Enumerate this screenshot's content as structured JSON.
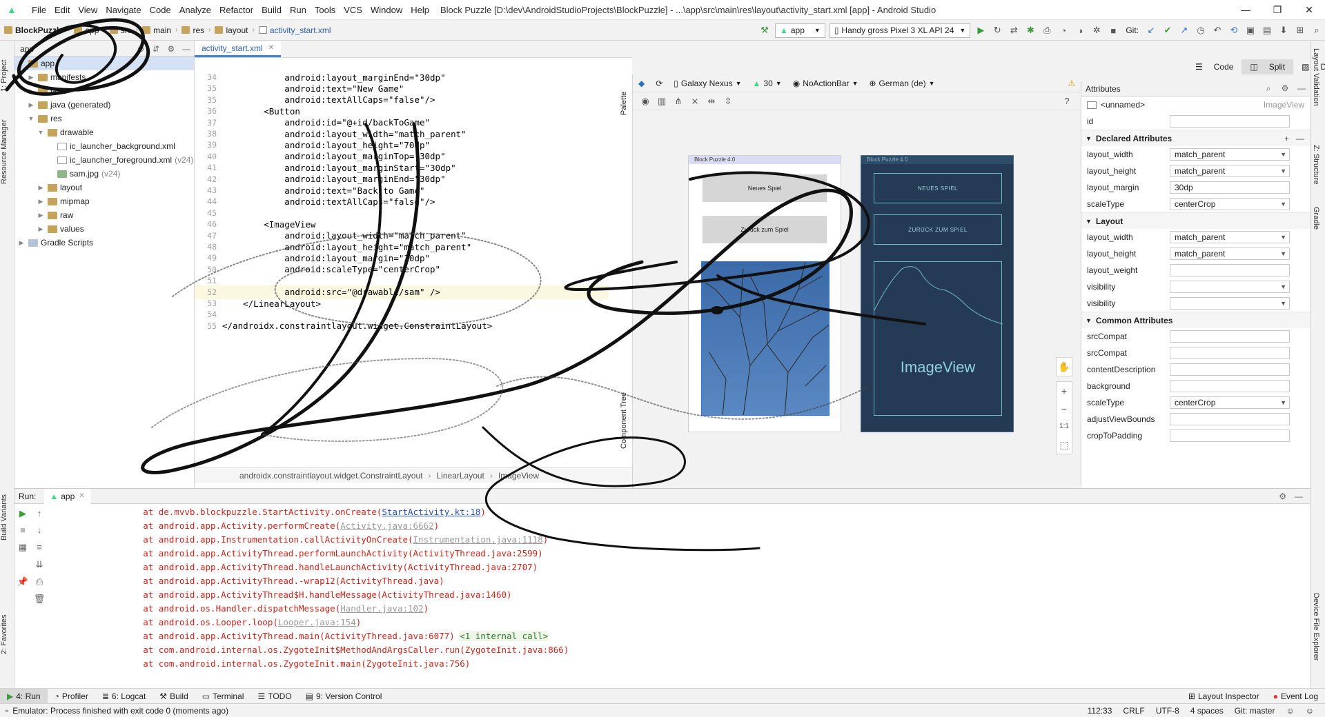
{
  "window": {
    "title": "Block Puzzle [D:\\dev\\AndroidStudioProjects\\BlockPuzzle] - ...\\app\\src\\main\\res\\layout\\activity_start.xml [app] - Android Studio",
    "menu": [
      "File",
      "Edit",
      "View",
      "Navigate",
      "Code",
      "Analyze",
      "Refactor",
      "Build",
      "Run",
      "Tools",
      "VCS",
      "Window",
      "Help"
    ],
    "controls": [
      "—",
      "❐",
      "✕"
    ]
  },
  "navbar": {
    "breadcrumbs": [
      "BlockPuzzle",
      "app",
      "src",
      "main",
      "res",
      "layout",
      "activity_start.xml"
    ],
    "run_config": "app",
    "device": "Handy gross Pixel 3 XL API 24",
    "git_label": "Git:"
  },
  "project": {
    "header": "app",
    "tree": [
      {
        "label": "app",
        "depth": 0,
        "kind": "folder",
        "note": ""
      },
      {
        "label": "manifests",
        "depth": 1,
        "kind": "folder",
        "note": ""
      },
      {
        "label": "java",
        "depth": 1,
        "kind": "folder",
        "note": ""
      },
      {
        "label": "java (generated)",
        "depth": 1,
        "kind": "folder",
        "note": ""
      },
      {
        "label": "res",
        "depth": 1,
        "kind": "folder",
        "note": ""
      },
      {
        "label": "drawable",
        "depth": 2,
        "kind": "folder",
        "note": ""
      },
      {
        "label": "ic_launcher_background.xml",
        "depth": 3,
        "kind": "xml",
        "note": ""
      },
      {
        "label": "ic_launcher_foreground.xml",
        "depth": 3,
        "kind": "xml",
        "note": "(v24)"
      },
      {
        "label": "sam.jpg",
        "depth": 3,
        "kind": "img",
        "note": "(v24)"
      },
      {
        "label": "layout",
        "depth": 2,
        "kind": "folder",
        "note": ""
      },
      {
        "label": "mipmap",
        "depth": 2,
        "kind": "folder",
        "note": ""
      },
      {
        "label": "raw",
        "depth": 2,
        "kind": "folder",
        "note": ""
      },
      {
        "label": "values",
        "depth": 2,
        "kind": "folder",
        "note": ""
      },
      {
        "label": "Gradle Scripts",
        "depth": 0,
        "kind": "gradle",
        "note": ""
      }
    ]
  },
  "editor": {
    "tab": "activity_start.xml",
    "lines": [
      {
        "n": "34",
        "text": "            android:layout_marginEnd=\"30dp\""
      },
      {
        "n": "35",
        "text": "            android:text=\"New Game\""
      },
      {
        "n": "35",
        "text": "            android:textAllCaps=\"false\"/>"
      },
      {
        "n": "36",
        "text": "        <Button"
      },
      {
        "n": "37",
        "text": "            android:id=\"@+id/backToGame\""
      },
      {
        "n": "38",
        "text": "            android:layout_width=\"match_parent\""
      },
      {
        "n": "39",
        "text": "            android:layout_height=\"70dp\""
      },
      {
        "n": "40",
        "text": "            android:layout_marginTop=\"30dp\""
      },
      {
        "n": "41",
        "text": "            android:layout_marginStart=\"30dp\""
      },
      {
        "n": "42",
        "text": "            android:layout_marginEnd=\"30dp\""
      },
      {
        "n": "43",
        "text": "            android:text=\"Back to Game\""
      },
      {
        "n": "44",
        "text": "            android:textAllCaps=\"false\"/>"
      },
      {
        "n": "45",
        "text": ""
      },
      {
        "n": "46",
        "text": "        <ImageView"
      },
      {
        "n": "47",
        "text": "            android:layout_width=\"match_parent\""
      },
      {
        "n": "48",
        "text": "            android:layout_height=\"match_parent\""
      },
      {
        "n": "49",
        "text": "            android:layout_margin=\"30dp\""
      },
      {
        "n": "50",
        "text": "            android:scaleType=\"centerCrop\""
      },
      {
        "n": "51",
        "text": ""
      },
      {
        "n": "52",
        "text": "            android:src=\"@drawable/sam\" />"
      },
      {
        "n": "53",
        "text": "    </LinearLayout>"
      },
      {
        "n": "54",
        "text": ""
      },
      {
        "n": "55",
        "text": "</androidx.constraintlayout.widget.ConstraintLayout>"
      }
    ],
    "breadcrumb": [
      "androidx.constraintlayout.widget.ConstraintLayout",
      "LinearLayout",
      "ImageView"
    ]
  },
  "design": {
    "view_modes": [
      "Code",
      "Split",
      "Design"
    ],
    "device": "Galaxy Nexus",
    "api": "30",
    "theme": "NoActionBar",
    "locale": "German (de)",
    "preview_title": "Block Puzzle 4.0",
    "btn_new": "Neues Spiel",
    "btn_back": "Zurück zum Spiel",
    "blueprint_btn_new": "NEUES SPIEL",
    "blueprint_btn_back": "ZURÜCK ZUM SPIEL",
    "blueprint_image_label": "ImageView",
    "zoom_ratio": "1:1",
    "palette_label": "Palette",
    "component_tree_label": "Component Tree"
  },
  "attributes": {
    "header": "Attributes",
    "component": "<unnamed>",
    "component_type": "ImageView",
    "id_label": "id",
    "declared_header": "Declared Attributes",
    "declared": [
      {
        "name": "layout_width",
        "value": "match_parent",
        "dropdown": true
      },
      {
        "name": "layout_height",
        "value": "match_parent",
        "dropdown": true
      },
      {
        "name": "layout_margin",
        "value": "30dp",
        "dropdown": false
      },
      {
        "name": "scaleType",
        "value": "centerCrop",
        "dropdown": true
      }
    ],
    "layout_header": "Layout",
    "layout": [
      {
        "name": "layout_width",
        "value": "match_parent",
        "dropdown": true
      },
      {
        "name": "layout_height",
        "value": "match_parent",
        "dropdown": true
      },
      {
        "name": "layout_weight",
        "value": "",
        "dropdown": false
      },
      {
        "name": "visibility",
        "value": "",
        "dropdown": true
      },
      {
        "name": "visibility",
        "value": "",
        "dropdown": true
      }
    ],
    "common_header": "Common Attributes",
    "common": [
      {
        "name": "srcCompat",
        "value": "",
        "dropdown": false
      },
      {
        "name": "srcCompat",
        "value": "",
        "dropdown": false
      },
      {
        "name": "contentDescription",
        "value": "",
        "dropdown": false
      },
      {
        "name": "background",
        "value": "",
        "dropdown": false
      },
      {
        "name": "scaleType",
        "value": "centerCrop",
        "dropdown": true
      },
      {
        "name": "adjustViewBounds",
        "value": "",
        "dropdown": false
      },
      {
        "name": "cropToPadding",
        "value": "",
        "dropdown": false
      }
    ]
  },
  "run": {
    "label": "Run:",
    "tab": "app",
    "log": [
      {
        "pre": "        at de.mvvb.blockpuzzle.StartActivity.onCreate(",
        "link": "StartActivity.kt:18",
        "post": ")",
        "kind": "lnk"
      },
      {
        "pre": "        at android.app.Activity.performCreate(",
        "link": "Activity.java:6662",
        "post": ")",
        "kind": "glnk"
      },
      {
        "pre": "        at android.app.Instrumentation.callActivityOnCreate(",
        "link": "Instrumentation.java:1118",
        "post": ")",
        "kind": "glnk"
      },
      {
        "pre": "        at android.app.ActivityThread.performLaunchActivity(ActivityThread.java:2599)",
        "link": "",
        "post": "",
        "kind": ""
      },
      {
        "pre": "        at android.app.ActivityThread.handleLaunchActivity(ActivityThread.java:2707)",
        "link": "",
        "post": "",
        "kind": ""
      },
      {
        "pre": "        at android.app.ActivityThread.-wrap12(ActivityThread.java)",
        "link": "",
        "post": "",
        "kind": ""
      },
      {
        "pre": "        at android.app.ActivityThread$H.handleMessage(ActivityThread.java:1460)",
        "link": "",
        "post": "",
        "kind": ""
      },
      {
        "pre": "        at android.os.Handler.dispatchMessage(",
        "link": "Handler.java:102",
        "post": ")",
        "kind": "glnk"
      },
      {
        "pre": "        at android.os.Looper.loop(",
        "link": "Looper.java:154",
        "post": ")",
        "kind": "glnk"
      },
      {
        "pre": "        at android.app.ActivityThread.main(ActivityThread.java:6077) ",
        "link": "<1 internal call>",
        "post": "",
        "kind": "note"
      },
      {
        "pre": "        at com.android.internal.os.ZygoteInit$MethodAndArgsCaller.run(ZygoteInit.java:866)",
        "link": "",
        "post": "",
        "kind": ""
      },
      {
        "pre": "        at com.android.internal.os.ZygoteInit.main(ZygoteInit.java:756)",
        "link": "",
        "post": "",
        "kind": ""
      }
    ]
  },
  "bottom_tabs": [
    "4: Run",
    "Profiler",
    "6: Logcat",
    "Build",
    "Terminal",
    "TODO",
    "9: Version Control"
  ],
  "bottom_right_tabs": [
    "Layout Inspector",
    "Event Log"
  ],
  "left_tabs": [
    "1: Project",
    "Resource Manager",
    "Build Variants",
    "2: Favorites"
  ],
  "right_tabs": [
    "Layout Validation",
    "Z: Structure",
    "Gradle",
    "Device File Explorer"
  ],
  "status": {
    "message": "Emulator: Process finished with exit code 0 (moments ago)",
    "position": "112:33",
    "line_sep": "CRLF",
    "encoding": "UTF-8",
    "indent": "4 spaces",
    "vcs": "Git: master"
  },
  "colors": {
    "accent": "#4083c9",
    "error_text": "#c8251b",
    "blueprint_bg": "#253b55",
    "image_blue": "#4a79b5"
  }
}
